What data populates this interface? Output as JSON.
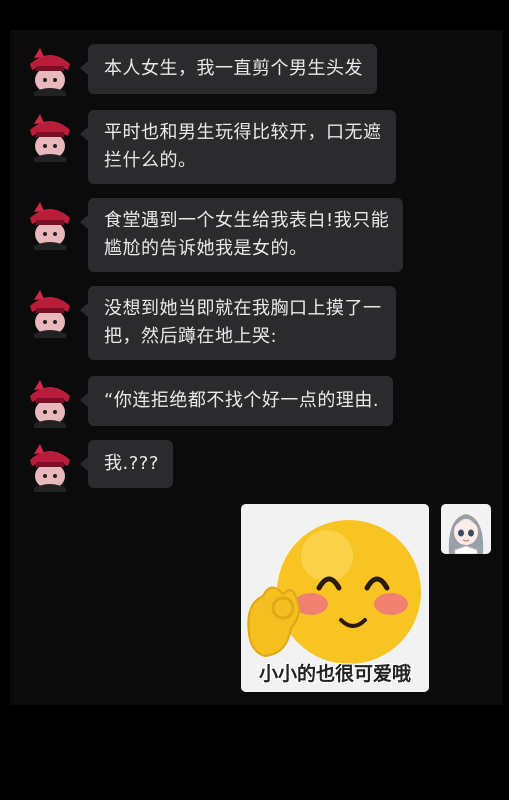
{
  "chat": {
    "messages": [
      {
        "sender": "other",
        "text": "本人女生，我一直剪个男生头发"
      },
      {
        "sender": "other",
        "text": "平时也和男生玩得比较开，口无遮\n拦什么的。"
      },
      {
        "sender": "other",
        "text": "食堂遇到一个女生给我表白!我只能\n尴尬的告诉她我是女的。"
      },
      {
        "sender": "other",
        "text": "没想到她当即就在我胸口上摸了一\n把，然后蹲在地上哭:"
      },
      {
        "sender": "other",
        "text": "“你连拒绝都不找个好一点的理由."
      },
      {
        "sender": "other",
        "text": "我.???"
      },
      {
        "sender": "me",
        "sticker_caption": "小小的也很可爱哦",
        "sticker_icon": "blushing-emoji-ok-hand"
      }
    ]
  },
  "colors": {
    "background": "#000000",
    "panel": "#0b0b0c",
    "bubble": "#2b2b2d",
    "bubble_text": "#e9e9e9",
    "emoji_yellow": "#f7c423"
  },
  "icons": {
    "other_avatar": "red-hat-character-avatar",
    "my_avatar": "anime-girl-avatar"
  }
}
